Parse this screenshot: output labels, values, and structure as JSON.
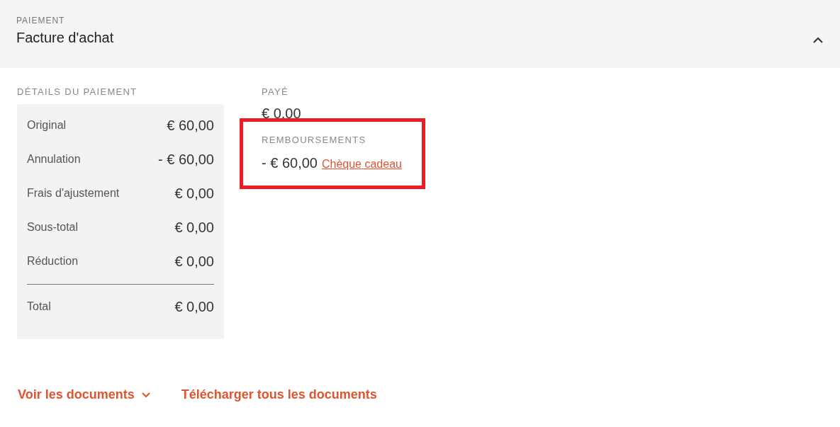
{
  "header": {
    "section_label": "PAIEMENT",
    "title": "Facture d'achat",
    "expanded": true
  },
  "payment_details": {
    "label": "DÉTAILS DU PAIEMENT",
    "rows": [
      {
        "label": "Original",
        "value": "€ 60,00"
      },
      {
        "label": "Annulation",
        "value": "- € 60,00"
      },
      {
        "label": "Frais d'ajustement",
        "value": "€ 0,00"
      },
      {
        "label": "Sous-total",
        "value": "€ 0,00"
      },
      {
        "label": "Réduction",
        "value": "€ 0,00"
      }
    ],
    "total": {
      "label": "Total",
      "value": "€ 0,00"
    }
  },
  "paid": {
    "label": "PAYÉ",
    "amount": "€ 0,00"
  },
  "refunds": {
    "label": "REMBOURSEMENTS",
    "amount": "- € 60,00",
    "method": "Chèque cadeau",
    "highlighted": true
  },
  "links": [
    {
      "label": "Voir les documents",
      "kind": "dropdown"
    },
    {
      "label": "Télécharger tous les documents",
      "kind": "plain"
    }
  ]
}
